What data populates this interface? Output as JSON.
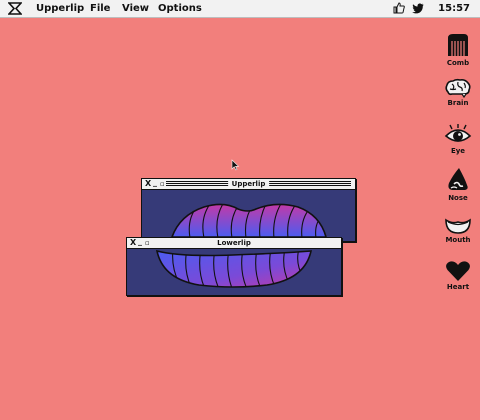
{
  "menubar": {
    "app_name": "Upperlip",
    "menus": [
      "File",
      "View",
      "Options"
    ],
    "time": "15:57",
    "status_icons": [
      "thumbs-up-icon",
      "twitter-bird-icon"
    ]
  },
  "desktop_icons": [
    {
      "label": "Comb",
      "icon": "comb-icon"
    },
    {
      "label": "Brain",
      "icon": "brain-icon"
    },
    {
      "label": "Eye",
      "icon": "eye-icon"
    },
    {
      "label": "Nose",
      "icon": "nose-icon"
    },
    {
      "label": "Mouth",
      "icon": "mouth-icon"
    },
    {
      "label": "Heart",
      "icon": "heart-icon"
    }
  ],
  "windows": [
    {
      "title": "Upperlip",
      "controls": {
        "close": "X",
        "minimize": "_",
        "maximize": "▫"
      }
    },
    {
      "title": "Lowerlip",
      "controls": {
        "close": "X",
        "minimize": "_",
        "maximize": "▫"
      }
    }
  ],
  "colors": {
    "desktop": "#f27f7c",
    "window_bg": "#363a78",
    "lip_gradient_start": "#4c5cf0",
    "lip_gradient_end": "#c23aa8"
  }
}
